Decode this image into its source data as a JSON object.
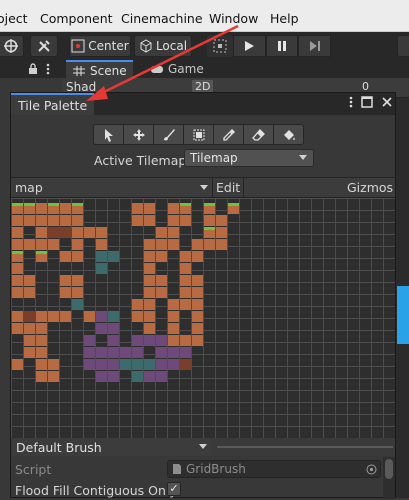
{
  "menu": {
    "items": [
      "oject",
      "Component",
      "Cinemachine",
      "Window",
      "Help"
    ]
  },
  "toolbar": {
    "pivot_label": "Center",
    "space_label": "Local"
  },
  "scene_tabs": {
    "scene": "Scene",
    "game": "Game",
    "shading": "Shad",
    "mode_2d": "2D",
    "hidden_count": "0"
  },
  "palette": {
    "title": "Tile Palette",
    "tools": [
      "select-tool",
      "move-tool",
      "brush-tool",
      "box-fill-tool",
      "picker-tool",
      "eraser-tool",
      "fill-tool"
    ],
    "active_tilemap_label": "Active Tilemap",
    "active_tilemap_value": "Tilemap",
    "palette_name": "map",
    "edit_label": "Edit",
    "gizmos_label": "Gizmos",
    "brush_value": "Default Brush",
    "script_label": "Script",
    "script_value": "GridBrush",
    "flood_fill_label": "Flood Fill Contiguous Only",
    "flood_fill_checked": true
  },
  "colors": {
    "accent_arrow": "#e53935",
    "tab_highlight": "#4a8df0",
    "tile_brown": "#b86a43",
    "tile_grass": "#6cc23a",
    "tile_purple": "#6e4a7a"
  }
}
